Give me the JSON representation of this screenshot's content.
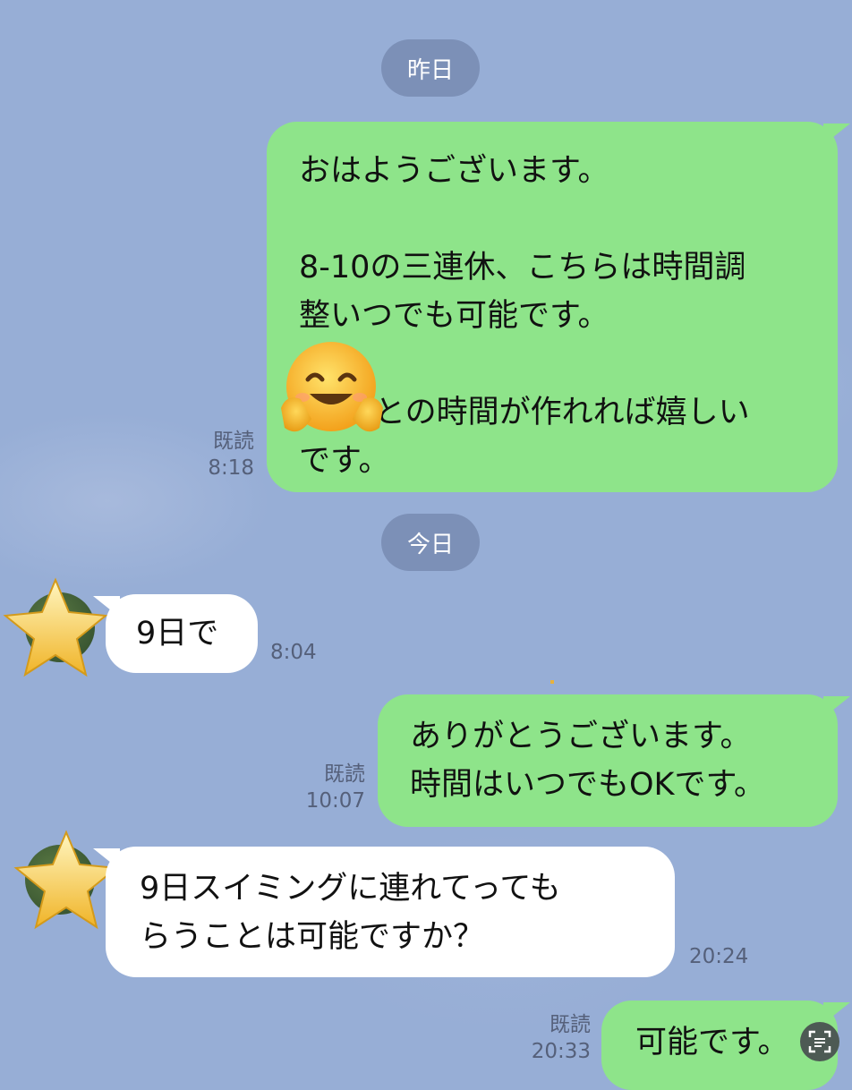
{
  "dates": {
    "yesterday": "昨日",
    "today": "今日"
  },
  "messages": [
    {
      "side": "sent",
      "lines": [
        "おはようございます。",
        "",
        "8-10の三連休、こちらは時間調",
        "整いつでも可能です。",
        "",
        "との時間が作れれば嬉しい",
        "です。"
      ],
      "read": "既読",
      "time": "8:18",
      "emoji": "smiling-face-open-hands"
    },
    {
      "side": "received",
      "lines": [
        "9日で"
      ],
      "time": "8:04"
    },
    {
      "side": "sent",
      "lines": [
        "ありがとうございます。",
        "時間はいつでもOKです。"
      ],
      "read": "既読",
      "time": "10:07"
    },
    {
      "side": "received",
      "lines": [
        "9日スイミングに連れてっても",
        "らうことは可能ですか？"
      ],
      "time": "20:24"
    },
    {
      "side": "sent",
      "lines": [
        "可能です。"
      ],
      "read": "既読",
      "time": "20:33"
    }
  ],
  "icons": {
    "avatar": "star-avatar",
    "corner": "scan-text-icon"
  }
}
